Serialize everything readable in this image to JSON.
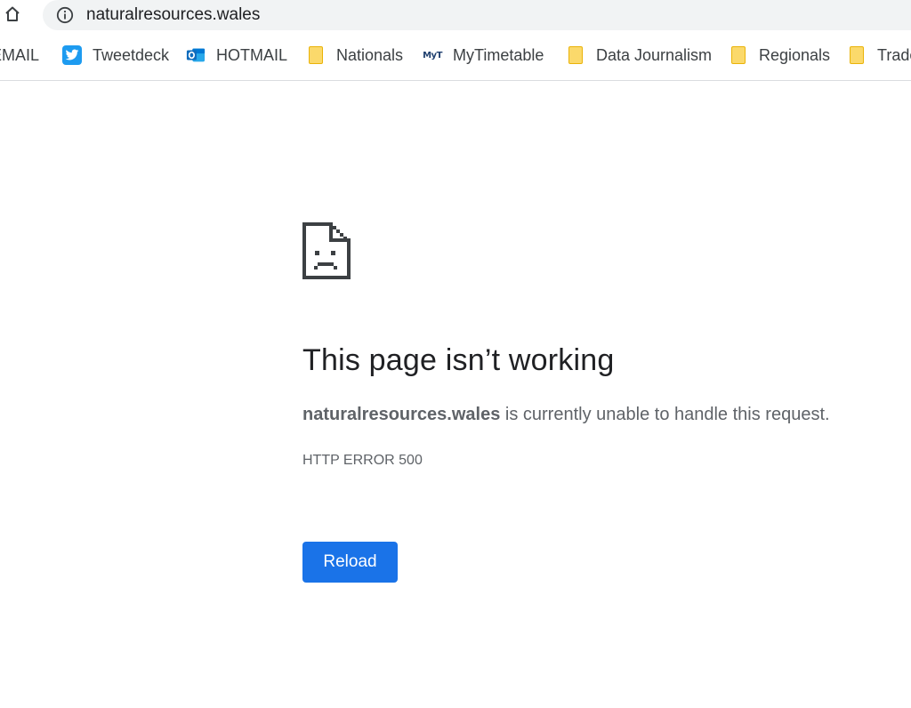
{
  "address_bar": {
    "url": "naturalresources.wales"
  },
  "bookmarks": [
    {
      "label": "EMAIL",
      "icon": "none"
    },
    {
      "label": "Tweetdeck",
      "icon": "twitter-icon"
    },
    {
      "label": "HOTMAIL",
      "icon": "outlook-icon"
    },
    {
      "label": "Nationals",
      "icon": "folder-icon"
    },
    {
      "label": "MyTimetable",
      "icon": "mytimetable-icon",
      "icon_text": "MyT"
    },
    {
      "label": "Data Journalism",
      "icon": "folder-icon"
    },
    {
      "label": "Regionals",
      "icon": "folder-icon"
    },
    {
      "label": "Trade",
      "icon": "folder-icon"
    }
  ],
  "error_page": {
    "title": "This page isn’t working",
    "host": "naturalresources.wales",
    "message_suffix": " is currently unable to handle this request.",
    "error_code": "HTTP ERROR 500",
    "reload_label": "Reload"
  },
  "colors": {
    "accent": "#1a73e8",
    "omnibox_bg": "#f1f3f4",
    "folder": "#fbd96b",
    "twitter": "#1d9bf0",
    "outlook": "#0f6cbd"
  }
}
